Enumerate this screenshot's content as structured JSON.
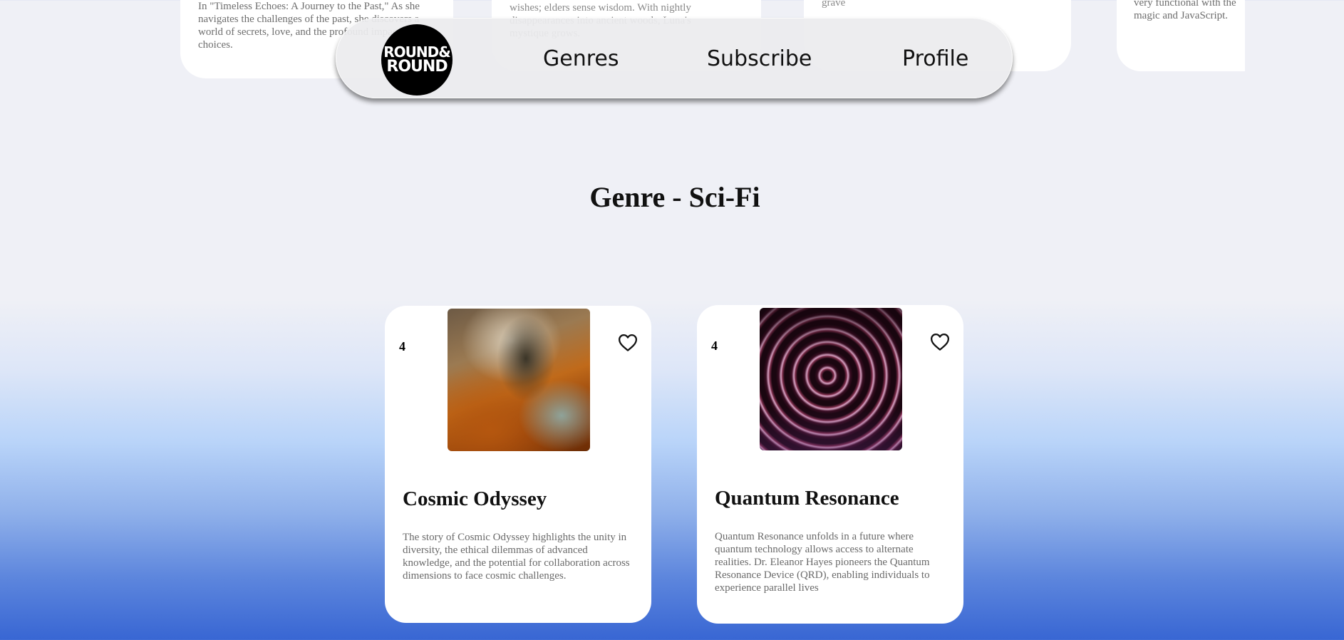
{
  "top_cards": [
    {
      "text": "In \"Timeless Echoes: A Journey to the Past,\" As she navigates the challenges of the past, she discovers a world of secrets, love, and the profound impact of choices."
    },
    {
      "text": "secrets in her gaze. Kids think she understands wishes; elders sense wisdom. With nightly disappearances into ancient woods, Luna's mystique grows."
    },
    {
      "text": "grave"
    },
    {
      "text": "very functional with the magic and JavaScript."
    }
  ],
  "nav": {
    "logo_line1": "ROUND&",
    "logo_line2": "ROUND",
    "links": [
      "Genres",
      "Subscribe",
      "Profile"
    ]
  },
  "genre": {
    "title": "Genre - Sci-Fi"
  },
  "books": [
    {
      "rating": "4",
      "title": "Cosmic Odyssey",
      "description": "The story of Cosmic Odyssey highlights the unity in diversity, the ethical dilemmas of advanced knowledge, and the potential for collaboration across dimensions to face cosmic challenges.",
      "cover_icon": "nebula-cover-image"
    },
    {
      "rating": "4",
      "title": "Quantum Resonance",
      "description": "Quantum Resonance unfolds in a future where quantum technology allows access to alternate realities. Dr. Eleanor Hayes pioneers the Quantum Resonance Device (QRD), enabling individuals to experience parallel lives",
      "cover_icon": "swirl-cover-image"
    }
  ],
  "icons": {
    "favorite": "heart-outline-icon"
  },
  "colors": {
    "background_top": "#eff0f6",
    "background_bottom": "#3866d3",
    "card": "#ffffff"
  }
}
